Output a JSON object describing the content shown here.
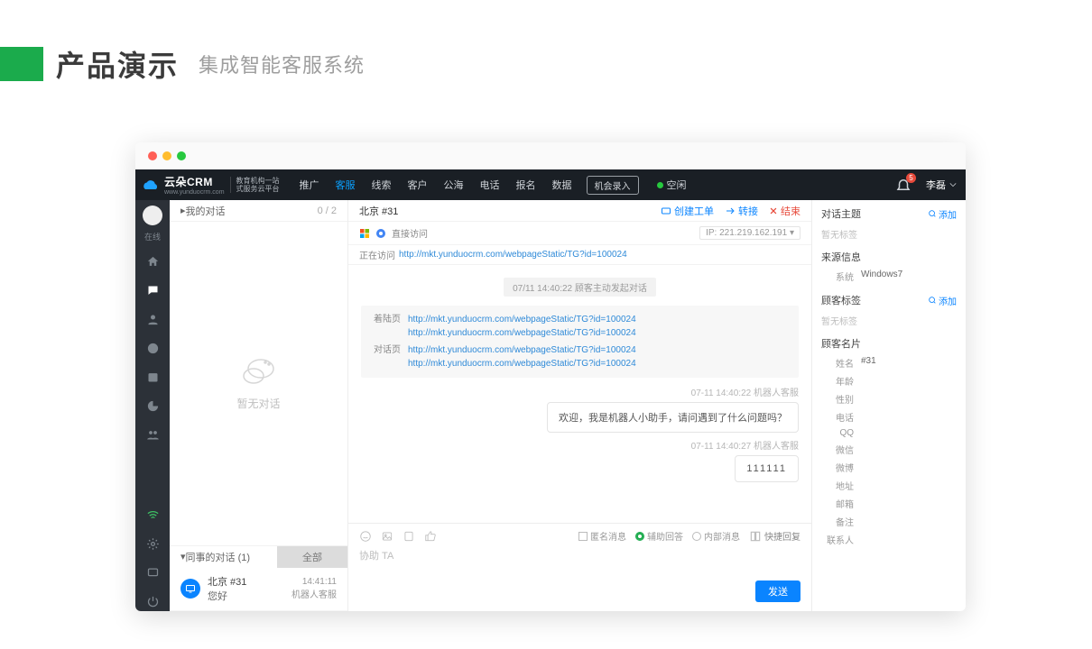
{
  "slide": {
    "title": "产品演示",
    "subtitle": "集成智能客服系统"
  },
  "brand": {
    "name": "云朵CRM",
    "site": "www.yunduocrm.com",
    "tag1": "教育机构一站",
    "tag2": "式服务云平台"
  },
  "nav": {
    "items": [
      "推广",
      "客服",
      "线索",
      "客户",
      "公海",
      "电话",
      "报名",
      "数据"
    ],
    "active_index": 1,
    "record_btn": "机会录入",
    "idle": "空闲",
    "notif_count": "5",
    "user": "李磊"
  },
  "rail": {
    "online": "在线"
  },
  "conv": {
    "my_title": "我的对话",
    "my_count": "0 / 2",
    "empty": "暂无对话",
    "coll_title": "同事的对话  (1)",
    "all_btn": "全部",
    "item": {
      "title": "北京  #31",
      "sub": "您好",
      "time": "14:41:11",
      "agent": "机器人客服"
    }
  },
  "chat": {
    "title": "北京 #31",
    "actions": {
      "ticket": "创建工单",
      "transfer": "转接",
      "end": "结束"
    },
    "access": {
      "label": "直接访问",
      "ip_prefix": "IP:",
      "ip": "221.219.162.191"
    },
    "visiting": {
      "label": "正在访问",
      "url": "http://mkt.yunduocrm.com/webpageStatic/TG?id=100024"
    },
    "pill": "07/11 14:40:22  顾客主动发起对话",
    "pages": {
      "land_label": "着陆页",
      "talk_label": "对话页",
      "url": "http://mkt.yunduocrm.com/webpageStatic/TG?id=100024"
    },
    "ts1": "07-11 14:40:22  机器人客服",
    "bubble1": "欢迎，我是机器人小助手，请问遇到了什么问题吗？",
    "ts2": "07-11 14:40:27  机器人客服",
    "bubble2": "111111",
    "tools": {
      "anon": "匿名消息",
      "assist": "辅助回答",
      "internal": "内部消息",
      "quick": "快捷回复"
    },
    "placeholder": "协助 TA",
    "send": "发送"
  },
  "info": {
    "topic_title": "对话主题",
    "add": "添加",
    "no_tag": "暂无标签",
    "source_title": "来源信息",
    "sys_k": "系统",
    "sys_v": "Windows7",
    "tag_title": "顾客标签",
    "card_title": "顾客名片",
    "fields": {
      "name_k": "姓名",
      "name_v": "#31",
      "age": "年龄",
      "sex": "性别",
      "tel": "电话",
      "qq": "QQ",
      "wx": "微信",
      "wb": "微博",
      "addr": "地址",
      "mail": "邮箱",
      "note": "备注",
      "contact": "联系人"
    }
  }
}
